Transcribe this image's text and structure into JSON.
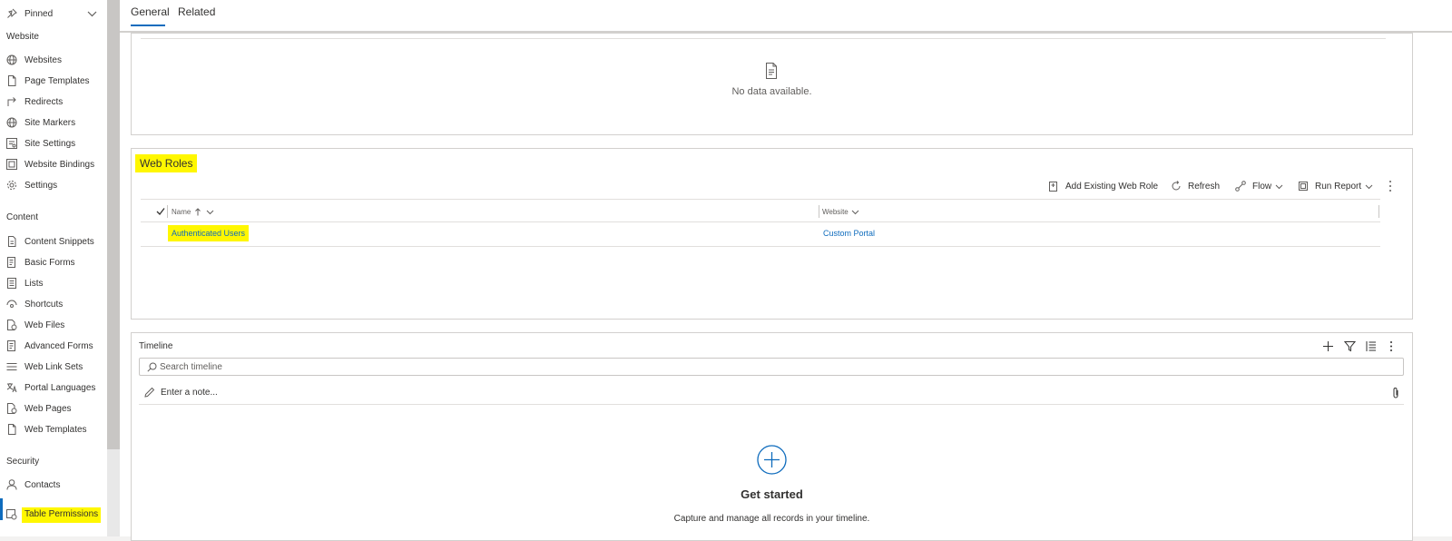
{
  "sidebar": {
    "pinned_label": "Pinned",
    "groups": [
      {
        "title": "Website",
        "items": [
          {
            "label": "Websites",
            "icon": "globe-icon"
          },
          {
            "label": "Page Templates",
            "icon": "document-icon"
          },
          {
            "label": "Redirects",
            "icon": "redirect-arrow-icon"
          },
          {
            "label": "Site Markers",
            "icon": "globe-icon"
          },
          {
            "label": "Site Settings",
            "icon": "settings-list-icon"
          },
          {
            "label": "Website Bindings",
            "icon": "binding-icon"
          },
          {
            "label": "Settings",
            "icon": "gear-icon"
          }
        ]
      },
      {
        "title": "Content",
        "items": [
          {
            "label": "Content Snippets",
            "icon": "snippet-icon"
          },
          {
            "label": "Basic Forms",
            "icon": "form-icon"
          },
          {
            "label": "Lists",
            "icon": "list-icon"
          },
          {
            "label": "Shortcuts",
            "icon": "shortcut-icon"
          },
          {
            "label": "Web Files",
            "icon": "web-file-icon"
          },
          {
            "label": "Advanced Forms",
            "icon": "form-icon"
          },
          {
            "label": "Web Link Sets",
            "icon": "link-set-icon"
          },
          {
            "label": "Portal Languages",
            "icon": "language-icon"
          },
          {
            "label": "Web Pages",
            "icon": "web-page-icon"
          },
          {
            "label": "Web Templates",
            "icon": "document-icon"
          }
        ]
      },
      {
        "title": "Security",
        "items": [
          {
            "label": "Contacts",
            "icon": "person-icon"
          },
          {
            "label": "Table Permissions",
            "icon": "table-permission-icon"
          }
        ]
      }
    ]
  },
  "tabs": {
    "general": "General",
    "related": "Related"
  },
  "top_section": {
    "empty_text": "No data available."
  },
  "web_roles": {
    "title": "Web Roles",
    "commands": {
      "add_existing": "Add Existing Web Role",
      "refresh": "Refresh",
      "flow": "Flow",
      "run_report": "Run Report"
    },
    "columns": {
      "name": "Name",
      "website": "Website"
    },
    "rows": [
      {
        "name": "Authenticated Users",
        "website": "Custom Portal"
      }
    ]
  },
  "timeline": {
    "title": "Timeline",
    "search_placeholder": "Search timeline",
    "note_placeholder": "Enter a note...",
    "empty_title": "Get started",
    "empty_subtitle": "Capture and manage all records in your timeline."
  },
  "colors": {
    "accent": "#0f6cbd",
    "highlight": "#fff700"
  }
}
